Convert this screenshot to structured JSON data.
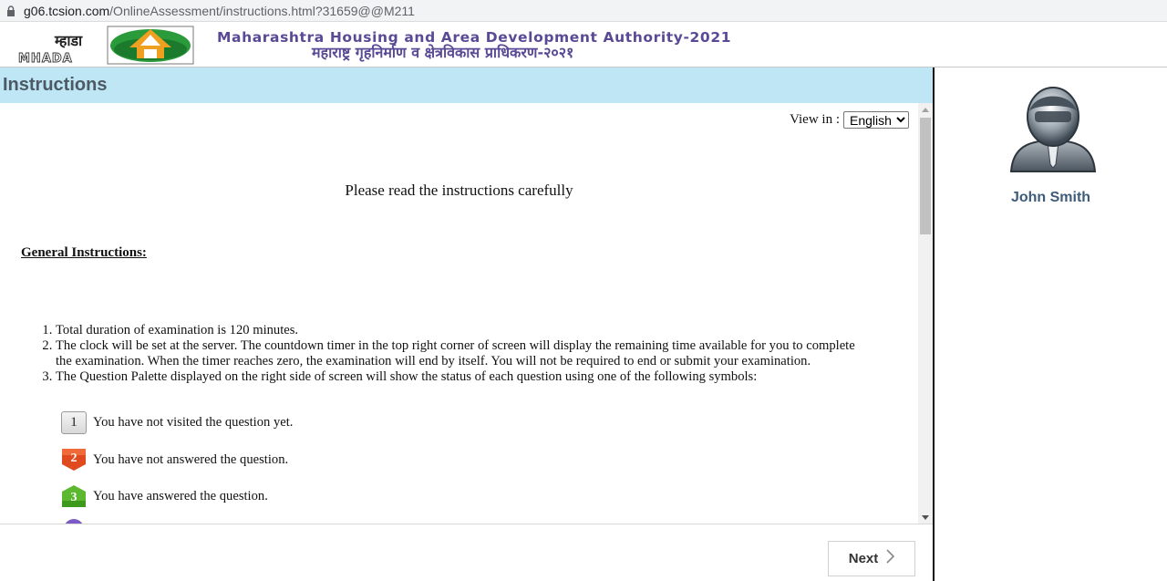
{
  "browser": {
    "url_host": "g06.tcsion.com",
    "url_path": "/OnlineAssessment/instructions.html?31659@@M211"
  },
  "banner": {
    "logo_text_mr": "म्हाडा",
    "logo_text_en": "MHADA",
    "title_en": "Maharashtra Housing and Area Development Authority-2021",
    "title_mr": "महाराष्ट्र गृहनिर्माण व क्षेत्रविकास प्राधिकरण-२०२१"
  },
  "main": {
    "header": "Instructions",
    "view_in_label": "View in :",
    "language_selected": "English",
    "please_read": "Please read the instructions carefully",
    "general_heading": "General Instructions:",
    "instructions": [
      "Total duration of examination is 120 minutes.",
      "The clock will be set at the server. The countdown timer in the top right corner of screen will display the remaining time available for you to complete the examination. When the timer reaches zero, the examination will end by itself. You will not be required to end or submit your examination.",
      "The Question Palette displayed on the right side of screen will show the status of each question using one of the following symbols:"
    ],
    "symbols": [
      {
        "number": "1",
        "text": "You have not visited the question yet."
      },
      {
        "number": "2",
        "text": "You have not answered the question."
      },
      {
        "number": "3",
        "text": "You have answered the question."
      }
    ],
    "next_label": "Next",
    "colors": {
      "header_bg": "#bfe6f4",
      "not_answered": "#e04a1f",
      "answered": "#5cb82e"
    }
  },
  "sidebar": {
    "user_name": "John Smith"
  }
}
